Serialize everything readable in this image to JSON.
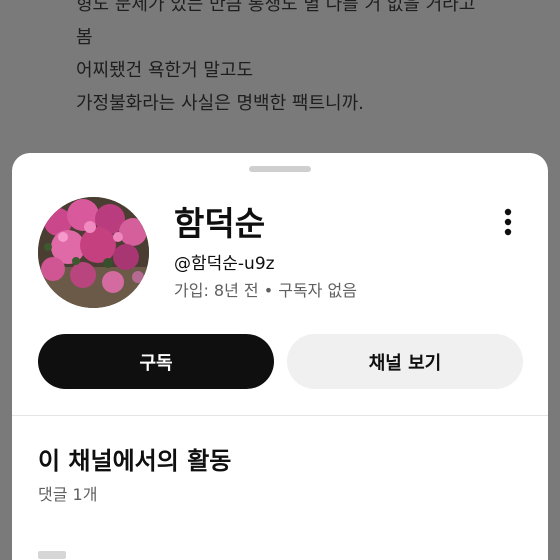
{
  "background_text": {
    "lines": [
      "형도 문제가 있는 만큼 통쟁도 별 다를 거 없을 거라고",
      "봄",
      "어찌됐건 욕한거 말고도",
      "가정불화라는 사실은 명백한 팩트니까."
    ]
  },
  "channel": {
    "name": "함덕순",
    "handle": "@함덕순-u9z",
    "meta": "가입: 8년 전 • 구독자 없음"
  },
  "buttons": {
    "subscribe": "구독",
    "view_channel": "채널 보기"
  },
  "activity": {
    "title": "이 채널에서의 활동",
    "subtitle": "댓글 1개"
  },
  "colors": {
    "overlay": "#7a7a7a",
    "sheet": "#ffffff",
    "primary_button": "#0f0f0f",
    "secondary_button": "#f0f0f0",
    "secondary_text": "#606060"
  },
  "icons": {
    "more": "more-vertical-icon",
    "avatar": "flower-photo"
  }
}
